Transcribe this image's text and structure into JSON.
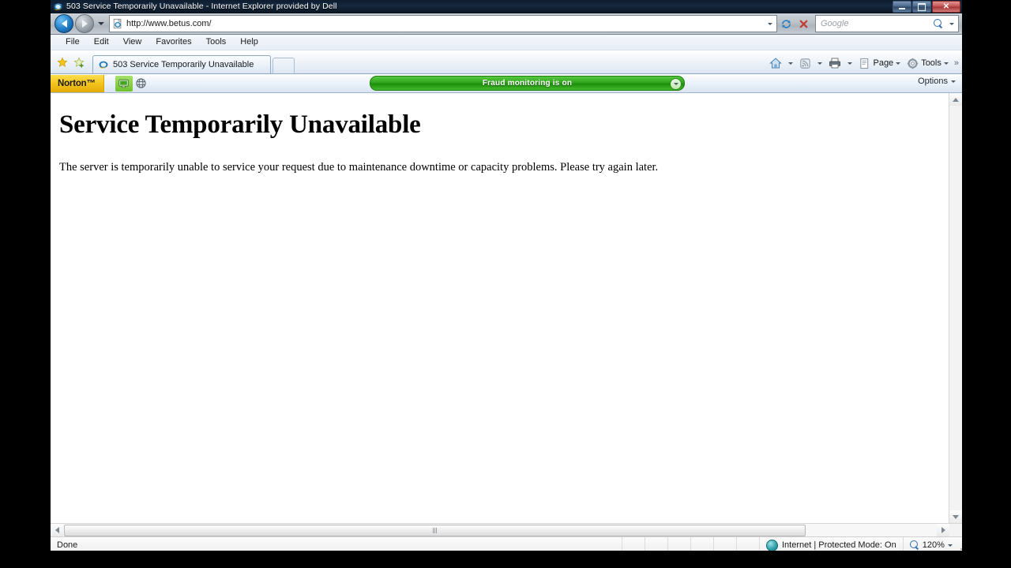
{
  "window": {
    "title": "503 Service Temporarily Unavailable - Internet Explorer provided by Dell",
    "app_icon": "ie-logo-icon",
    "controls": {
      "minimize": "Minimize",
      "restore": "Restore",
      "close": "Close"
    }
  },
  "navigation": {
    "back_tooltip": "Back",
    "forward_tooltip": "Forward",
    "recent_pages_tooltip": "Recent Pages",
    "address": {
      "value": "http://www.betus.com/",
      "placeholder": "",
      "favicon": "page-icon"
    },
    "refresh_tooltip": "Refresh",
    "stop_tooltip": "Stop",
    "search": {
      "placeholder": "Google",
      "value": "",
      "icon": "search-magnifier-icon"
    }
  },
  "menubar": {
    "items": [
      {
        "label": "File"
      },
      {
        "label": "Edit"
      },
      {
        "label": "View"
      },
      {
        "label": "Favorites"
      },
      {
        "label": "Tools"
      },
      {
        "label": "Help"
      }
    ]
  },
  "tabs": {
    "favorites_center_tooltip": "Favorites Center",
    "add_favorite_tooltip": "Add to Favorites",
    "items": [
      {
        "label": "503 Service Temporarily Unavailable",
        "active": true
      }
    ],
    "new_tab_tooltip": "New Tab"
  },
  "command_bar": {
    "home_label": "Home",
    "feeds_label": "Feeds",
    "print_label": "Print",
    "page_label": "Page",
    "tools_label": "Tools",
    "overflow_label": "»"
  },
  "norton_toolbar": {
    "brand": "Norton",
    "trademark": "™",
    "identity_safe_tooltip": "Identity Safe",
    "site_safety_tooltip": "Norton Safe Web",
    "fraud_status": "Fraud monitoring is on",
    "options_label": "Options"
  },
  "page": {
    "heading": "Service Temporarily Unavailable",
    "body": "The server is temporarily unable to service your request due to maintenance downtime or capacity problems. Please try again later."
  },
  "status_bar": {
    "status_text": "Done",
    "zone_text": "Internet | Protected Mode: On",
    "zone_icon": "internet-globe-icon",
    "zoom_level": "120%"
  },
  "colors": {
    "titlebar": "#0d1c2e",
    "norton_gold": "#f4c41d",
    "fraud_green": "#31a61c",
    "accent_blue": "#1e7bc4"
  }
}
